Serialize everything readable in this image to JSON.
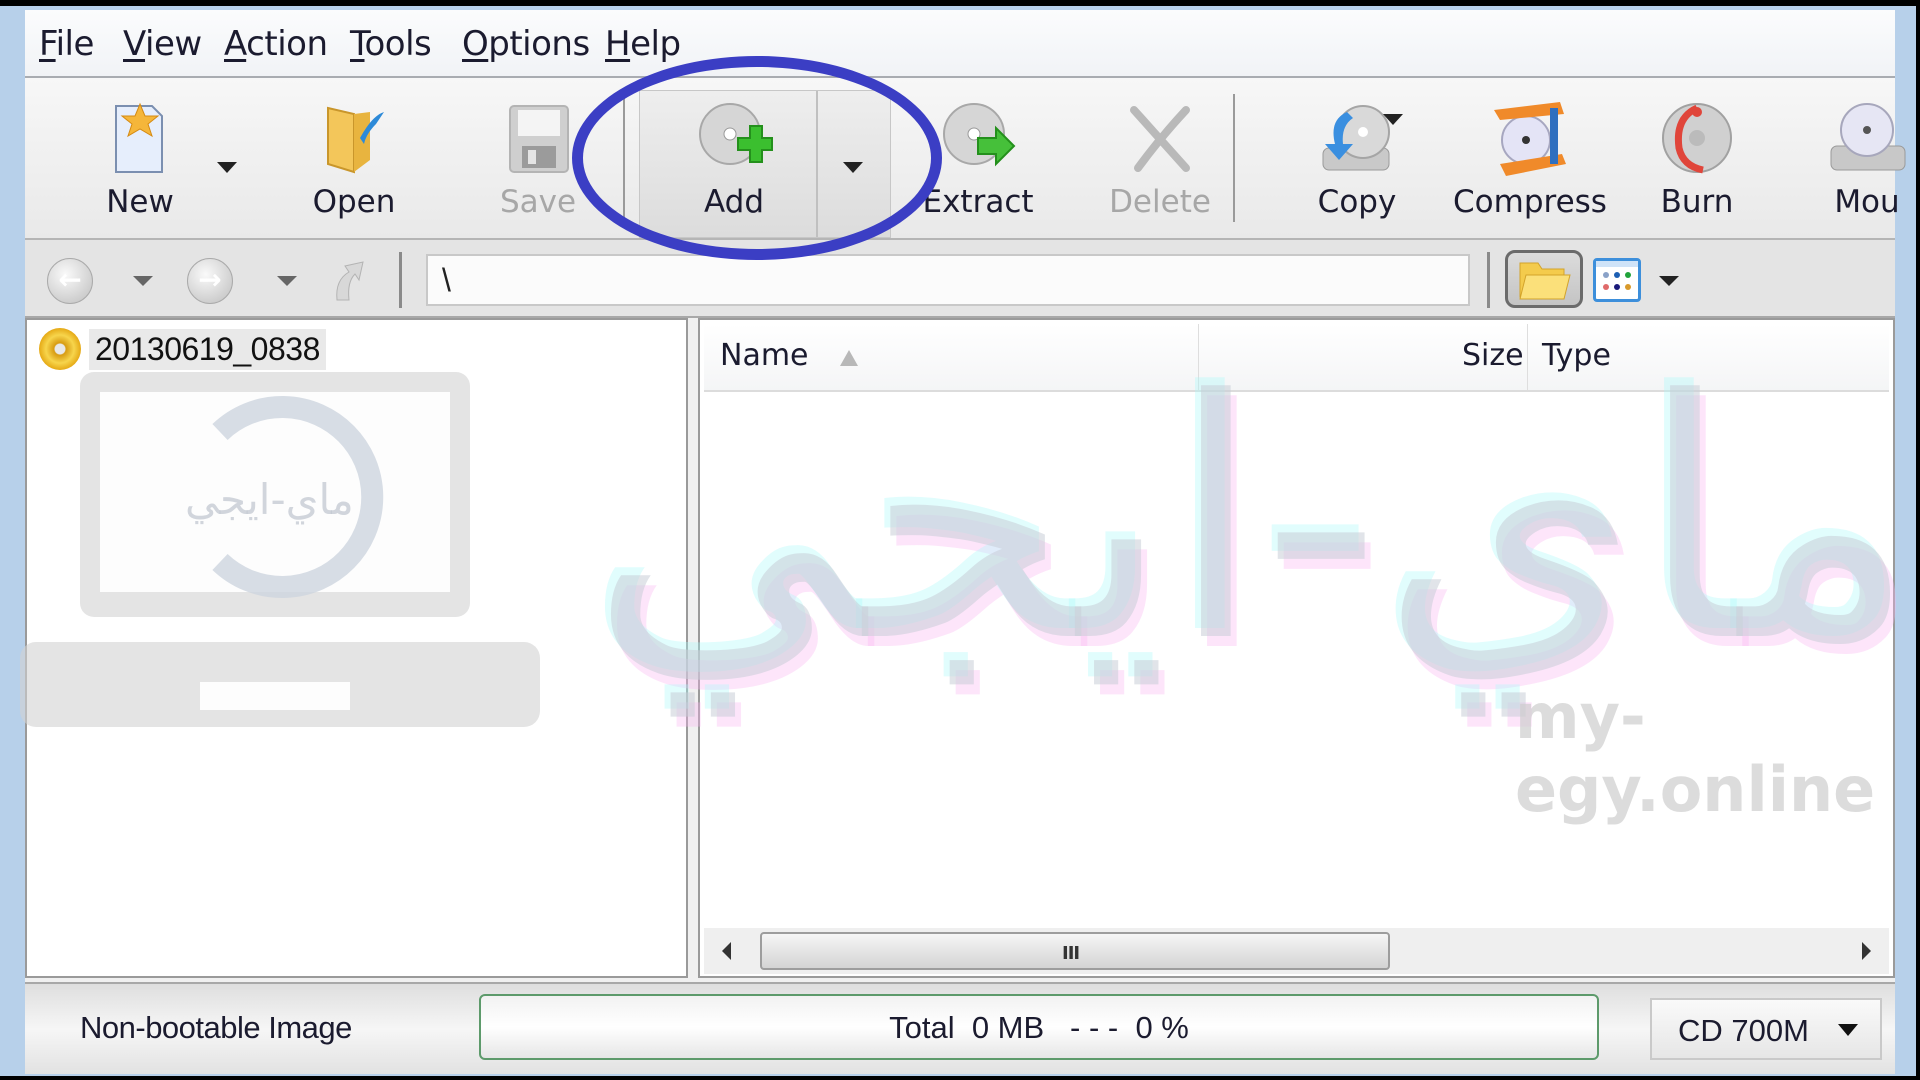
{
  "menu": {
    "items": [
      {
        "label": "File",
        "mnemonic": "F"
      },
      {
        "label": "View",
        "mnemonic": "V"
      },
      {
        "label": "Action",
        "mnemonic": "A"
      },
      {
        "label": "Tools",
        "mnemonic": "T"
      },
      {
        "label": "Options",
        "mnemonic": "O"
      },
      {
        "label": "Help",
        "mnemonic": "H"
      }
    ]
  },
  "toolbar": {
    "new": {
      "label": "New",
      "icon": "new-document-icon",
      "enabled": true
    },
    "open": {
      "label": "Open",
      "icon": "open-folder-icon",
      "enabled": true
    },
    "save": {
      "label": "Save",
      "icon": "floppy-disk-icon",
      "enabled": false
    },
    "add": {
      "label": "Add",
      "icon": "disc-add-icon",
      "enabled": true,
      "highlighted": true
    },
    "extract": {
      "label": "Extract",
      "icon": "disc-extract-icon",
      "enabled": true
    },
    "delete": {
      "label": "Delete",
      "icon": "delete-x-icon",
      "enabled": false
    },
    "copy": {
      "label": "Copy",
      "icon": "disc-copy-icon",
      "enabled": true
    },
    "compress": {
      "label": "Compress",
      "icon": "disc-compress-icon",
      "enabled": true
    },
    "burn": {
      "label": "Burn",
      "icon": "disc-burn-icon",
      "enabled": true
    },
    "mount": {
      "label": "Mou",
      "icon": "disc-mount-icon",
      "enabled": true
    }
  },
  "nav": {
    "path": "\\",
    "back_icon": "back-arrow-icon",
    "forward_icon": "forward-arrow-icon",
    "up_icon": "up-folder-icon"
  },
  "tree": {
    "items": [
      {
        "label": "20130619_0838",
        "icon": "cd-image-icon"
      }
    ]
  },
  "list": {
    "columns": [
      {
        "label": "Name",
        "sorted": "ascending"
      },
      {
        "label": "Size"
      },
      {
        "label": "Type"
      }
    ],
    "rows": [],
    "scroll_grip": "III"
  },
  "status": {
    "boot_text": "Non-bootable Image",
    "progress_text": "Total  0 MB   - - -  0 %",
    "progress_percent": 0,
    "media": "CD 700M"
  },
  "watermark": {
    "arabic": "ماي-ايجي",
    "url": "my-egy.online"
  },
  "colors": {
    "annotation": "#3b3ec4",
    "progress_border": "#5d9a6b",
    "window_frame": "#b7d0ea"
  }
}
